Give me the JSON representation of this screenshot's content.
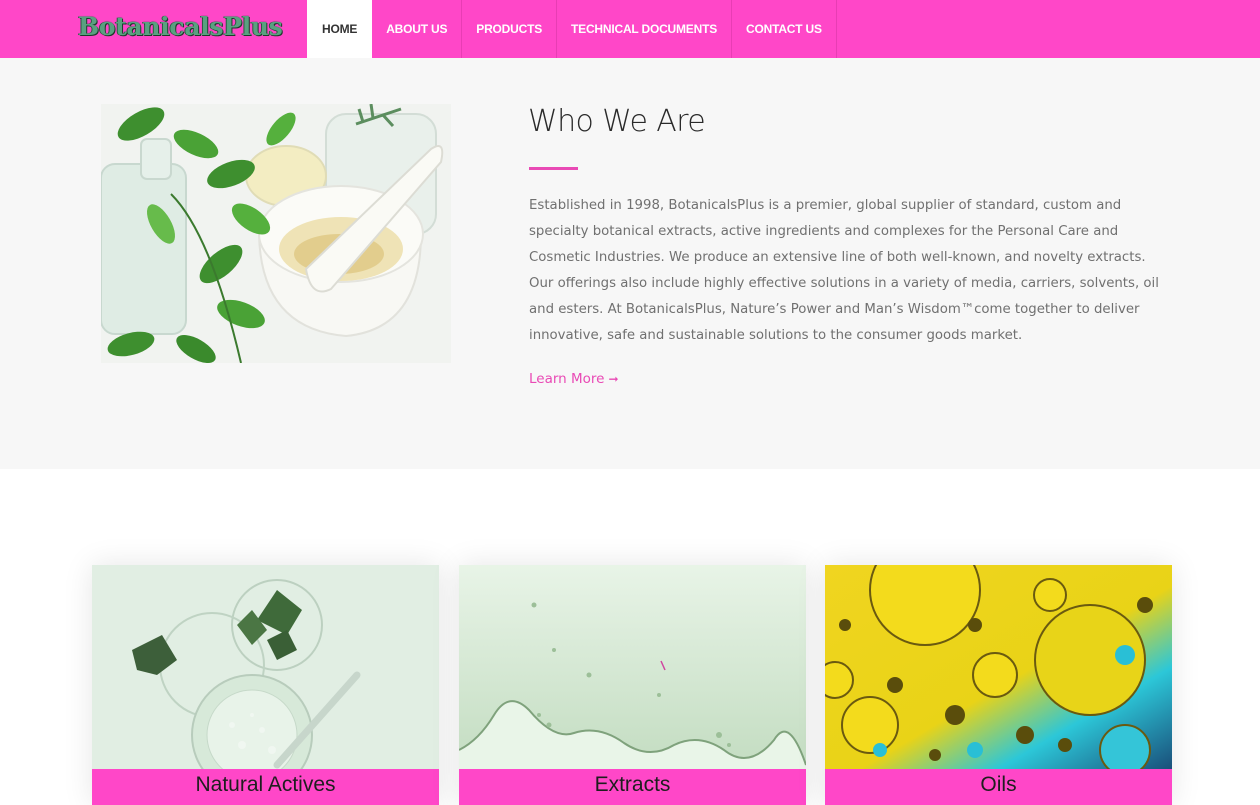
{
  "brand": {
    "name": "BotanicalsPlus"
  },
  "nav": {
    "items": [
      {
        "label": "HOME",
        "active": true
      },
      {
        "label": "ABOUT US",
        "active": false
      },
      {
        "label": "PRODUCTS",
        "active": false
      },
      {
        "label": "TECHNICAL DOCUMENTS",
        "active": false
      },
      {
        "label": "CONTACT US",
        "active": false
      }
    ]
  },
  "about": {
    "title": "Who We Are",
    "body": "Established in 1998, BotanicalsPlus is a premier, global supplier of standard, custom and specialty botanical extracts, active ingredients and complexes for the Personal Care and Cosmetic Industries. We produce an extensive line of both well-known, and novelty extracts. Our offerings also include highly effective solutions in a variety of media, carriers, solvents, oil and esters. At BotanicalsPlus, Nature’s Power and Man’s Wisdom™come together to deliver innovative, safe and sustainable solutions to the consumer goods market.",
    "learn_more": "Learn More",
    "learn_more_icon": "arrow-right-icon"
  },
  "cards": [
    {
      "label": "Natural Actives"
    },
    {
      "label": "Extracts"
    },
    {
      "label": "Oils"
    }
  ],
  "colors": {
    "brand_pink": "#ff47c8",
    "accent_pink": "#e94ab5",
    "about_bg": "#f7f7f7",
    "text_gray": "#707070"
  }
}
